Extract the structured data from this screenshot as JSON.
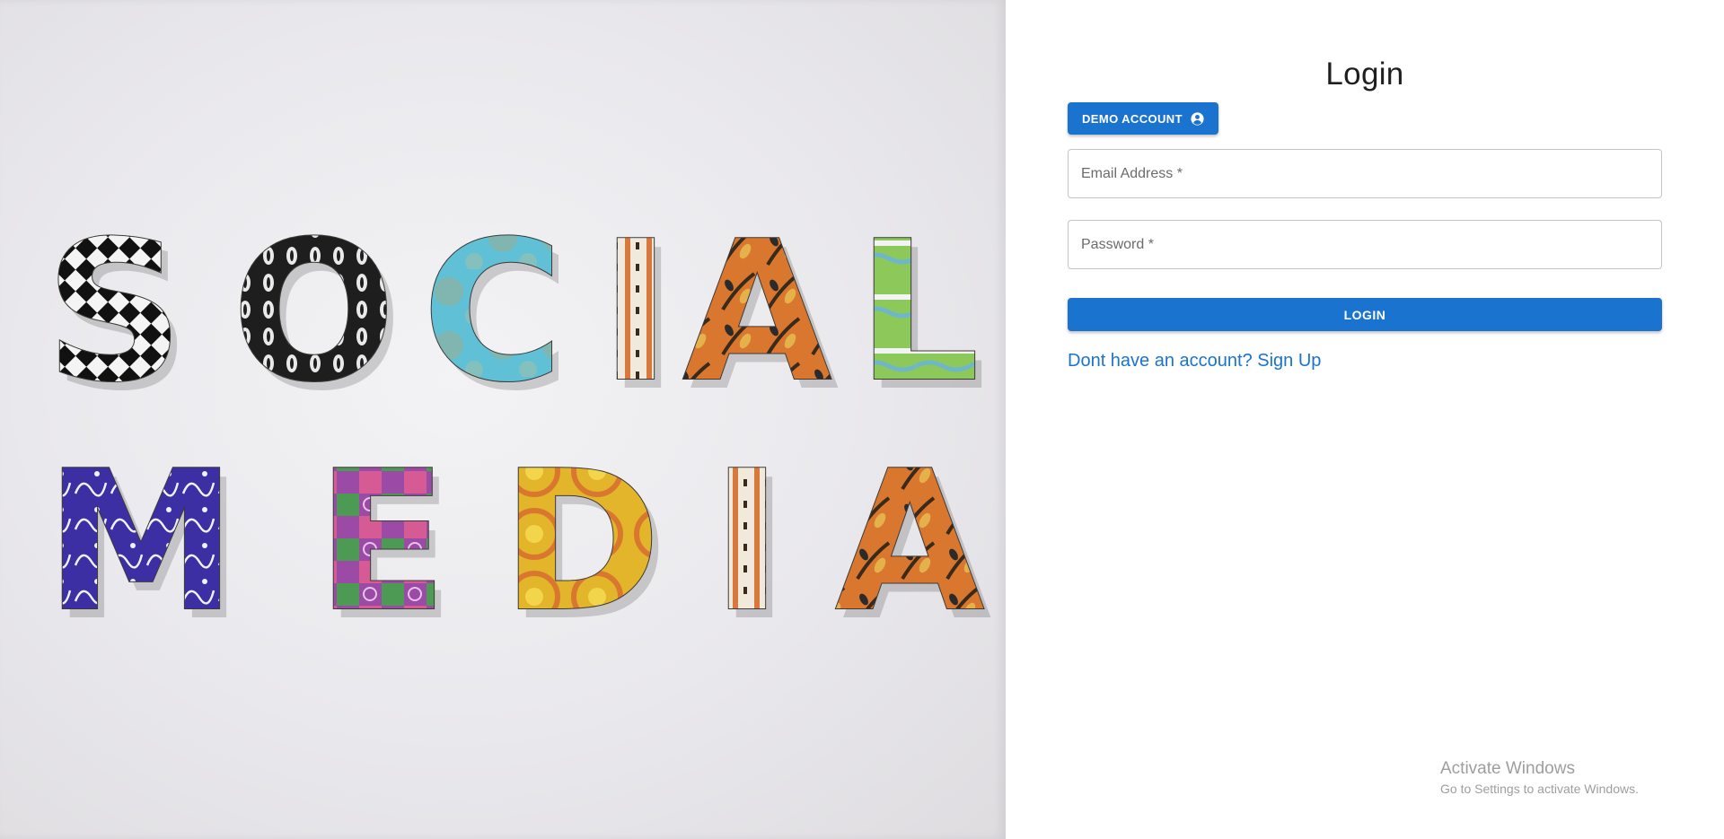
{
  "hero": {
    "row1": [
      "S",
      "O",
      "C",
      "I",
      "A",
      "L"
    ],
    "row2": [
      "M",
      "E",
      "D",
      "I",
      "A"
    ],
    "letter_colors_row1": [
      "#ffffff",
      "#2a2a2a",
      "#5bbfd6",
      "#d8793b",
      "#d9772f",
      "#8cc95a"
    ],
    "letter_colors_row2": [
      "#3b2fa3",
      "#9b4aa6",
      "#e2b52a",
      "#d8793b",
      "#d9772f"
    ]
  },
  "login": {
    "title": "Login",
    "demo_button": "DEMO ACCOUNT",
    "demo_icon": "account-circle-icon",
    "email_placeholder": "Email Address *",
    "password_placeholder": "Password *",
    "login_button": "LOGIN",
    "signup_link": "Dont have an account? Sign Up"
  },
  "watermark": {
    "title": "Activate Windows",
    "subtitle": "Go to Settings to activate Windows."
  },
  "colors": {
    "primary": "#1a73cf",
    "field_border": "#c4c4c4"
  }
}
